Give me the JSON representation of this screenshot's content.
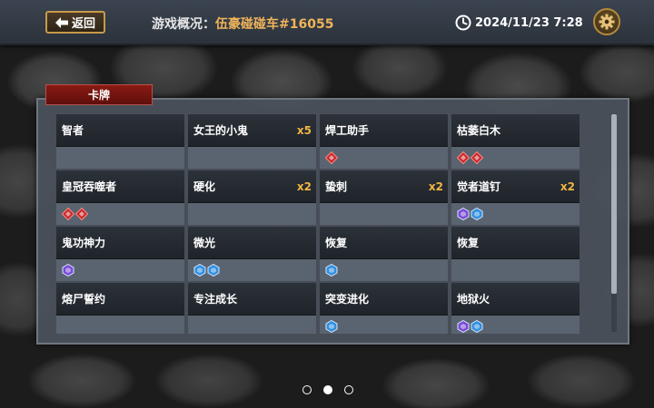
{
  "header": {
    "back_label": "返回",
    "title_prefix": "游戏概况：",
    "game_name": "伍豪碰碰车#16055",
    "datetime": "2024/11/23 7:28"
  },
  "panel": {
    "tab_label": "卡牌"
  },
  "cards": [
    {
      "name": "智者",
      "count": "",
      "gems": []
    },
    {
      "name": "女王的小鬼",
      "count": "x5",
      "gems": []
    },
    {
      "name": "焊工助手",
      "count": "",
      "gems": [
        "red"
      ]
    },
    {
      "name": "枯萎白木",
      "count": "",
      "gems": [
        "red",
        "red"
      ]
    },
    {
      "name": "皇冠吞噬者",
      "count": "",
      "gems": [
        "red",
        "red"
      ]
    },
    {
      "name": "硬化",
      "count": "x2",
      "gems": []
    },
    {
      "name": "蛰刺",
      "count": "x2",
      "gems": []
    },
    {
      "name": "觉者道钉",
      "count": "x2",
      "gems": [
        "purple",
        "blue"
      ]
    },
    {
      "name": "鬼功神力",
      "count": "",
      "gems": [
        "purple"
      ]
    },
    {
      "name": "微光",
      "count": "",
      "gems": [
        "blue",
        "blue"
      ]
    },
    {
      "name": "恢复",
      "count": "",
      "gems": [
        "blue"
      ]
    },
    {
      "name": "恢复",
      "count": "",
      "gems": []
    },
    {
      "name": "熔尸誓约",
      "count": "",
      "gems": []
    },
    {
      "name": "专注成长",
      "count": "",
      "gems": []
    },
    {
      "name": "突变进化",
      "count": "",
      "gems": [
        "blue"
      ]
    },
    {
      "name": "地狱火",
      "count": "",
      "gems": [
        "purple",
        "blue"
      ]
    }
  ],
  "gem_colors": {
    "red": "#c8262a",
    "purple": "#7a4bd8",
    "blue": "#2f8fe0"
  },
  "pager": {
    "pages": 3,
    "active": 2
  }
}
